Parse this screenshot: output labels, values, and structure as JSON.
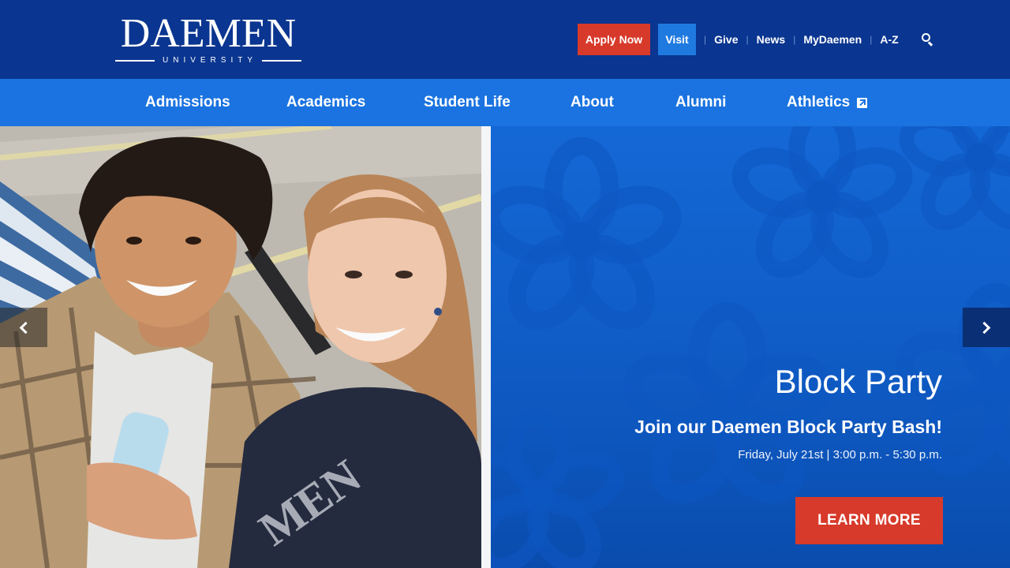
{
  "logo": {
    "wordmark": "DAEMEN",
    "subtitle": "UNIVERSITY"
  },
  "utility": {
    "apply_label": "Apply Now",
    "visit_label": "Visit",
    "links": [
      "Give",
      "News",
      "MyDaemen",
      "A-Z"
    ],
    "search_icon": "search-icon"
  },
  "nav": {
    "items": [
      "Admissions",
      "Academics",
      "Student Life",
      "About",
      "Alumni",
      "Athletics"
    ],
    "athletics_icon": "external-link-icon"
  },
  "hero": {
    "title": "Block Party",
    "subtitle": "Join our Daemen Block Party Bash!",
    "date": "Friday, July 21st | 3:00 p.m. - 5:30 p.m.",
    "cta_label": "LEARN MORE",
    "prev_icon": "chevron-left-icon",
    "next_icon": "chevron-right-icon"
  },
  "colors": {
    "header_bg": "#0a3590",
    "nav_bg": "#1a73e0",
    "apply_red": "#d73a2a",
    "visit_blue": "#1f7ae0",
    "hero_blue": "#1468d6"
  }
}
